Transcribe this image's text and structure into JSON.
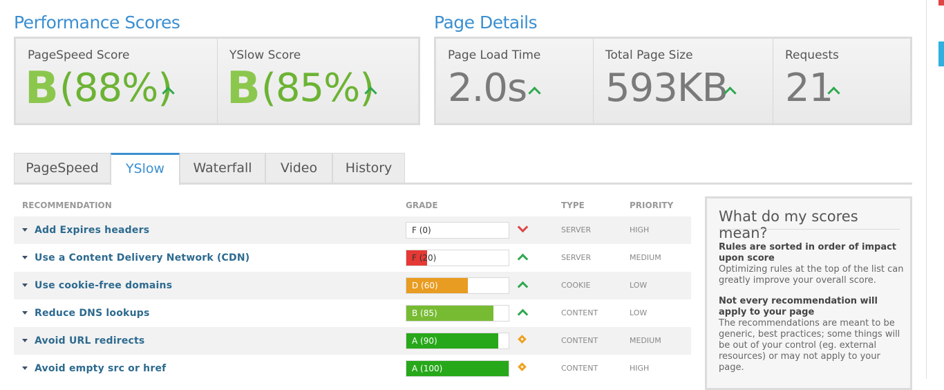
{
  "performance": {
    "title": "Performance Scores",
    "pagespeed": {
      "label": "PageSpeed Score",
      "grade": "B",
      "percent": "(88%)"
    },
    "yslow": {
      "label": "YSlow Score",
      "grade": "B",
      "percent": "(85%)"
    }
  },
  "details": {
    "title": "Page Details",
    "load_time": {
      "label": "Page Load Time",
      "value": "2.0s"
    },
    "page_size": {
      "label": "Total Page Size",
      "value": "593KB"
    },
    "requests": {
      "label": "Requests",
      "value": "21"
    }
  },
  "tabs": [
    "PageSpeed",
    "YSlow",
    "Waterfall",
    "Video",
    "History"
  ],
  "active_tab": "YSlow",
  "table": {
    "headers": {
      "recommendation": "RECOMMENDATION",
      "grade": "GRADE",
      "type": "TYPE",
      "priority": "PRIORITY"
    },
    "rows": [
      {
        "name": "Add Expires headers",
        "grade": "F (0)",
        "score": 0,
        "color": "#e53935",
        "trend": "down",
        "type": "SERVER",
        "priority": "HIGH"
      },
      {
        "name": "Use a Content Delivery Network (CDN)",
        "grade": "F (20)",
        "score": 20,
        "color": "#e53935",
        "trend": "up",
        "type": "SERVER",
        "priority": "MEDIUM"
      },
      {
        "name": "Use cookie-free domains",
        "grade": "D (60)",
        "score": 60,
        "color": "#e89c21",
        "trend": "up",
        "type": "COOKIE",
        "priority": "LOW"
      },
      {
        "name": "Reduce DNS lookups",
        "grade": "B (85)",
        "score": 85,
        "color": "#77bb33",
        "trend": "up",
        "type": "CONTENT",
        "priority": "LOW"
      },
      {
        "name": "Avoid URL redirects",
        "grade": "A (90)",
        "score": 90,
        "color": "#27a81a",
        "trend": "neutral",
        "type": "CONTENT",
        "priority": "MEDIUM"
      },
      {
        "name": "Avoid empty src or href",
        "grade": "A (100)",
        "score": 100,
        "color": "#27a81a",
        "trend": "neutral",
        "type": "CONTENT",
        "priority": "HIGH"
      }
    ]
  },
  "help": {
    "title": "What do my scores mean?",
    "p1_bold": "Rules are sorted in order of impact upon score",
    "p1_text": "Optimizing rules at the top of the list can greatly improve your overall score.",
    "p2_bold": "Not every recommendation will apply to your page",
    "p2_text": "The recommendations are meant to be generic, best practices; some things will be out of your control (eg. external resources) or may not apply to your page."
  },
  "colors": {
    "accent": "#3b8fd0",
    "grade_green": "#8cc74d",
    "trend_up": "#2fa84f",
    "trend_down": "#e04545",
    "neutral": "#f0a020"
  }
}
